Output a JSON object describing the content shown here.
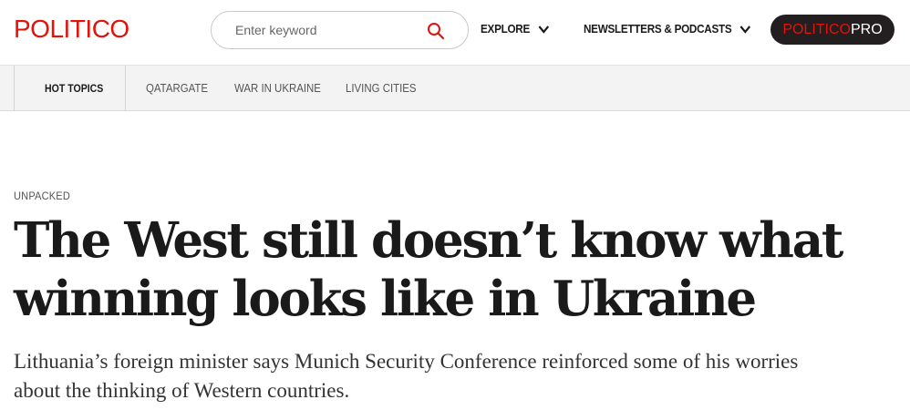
{
  "header": {
    "logo": "POLITICO",
    "search_placeholder": "Enter keyword",
    "explore_label": "EXPLORE",
    "newsletters_label": "NEWSLETTERS & PODCASTS",
    "pro_label_a": "POLITICO",
    "pro_label_b": "PRO"
  },
  "topics": {
    "lead": "HOT TOPICS",
    "items": [
      "QATARGATE",
      "WAR IN UKRAINE",
      "LIVING CITIES"
    ]
  },
  "article": {
    "kicker": "UNPACKED",
    "headline": "The West still doesn’t know what winning looks like in Ukraine",
    "dek": "Lithuania’s foreign minister says Munich Security Conference reinforced some of his worries about the thinking of Western countries."
  },
  "colors": {
    "brand_red": "#e3120b",
    "pro_bg": "#231f20",
    "topics_bg": "#f3f3f3"
  }
}
